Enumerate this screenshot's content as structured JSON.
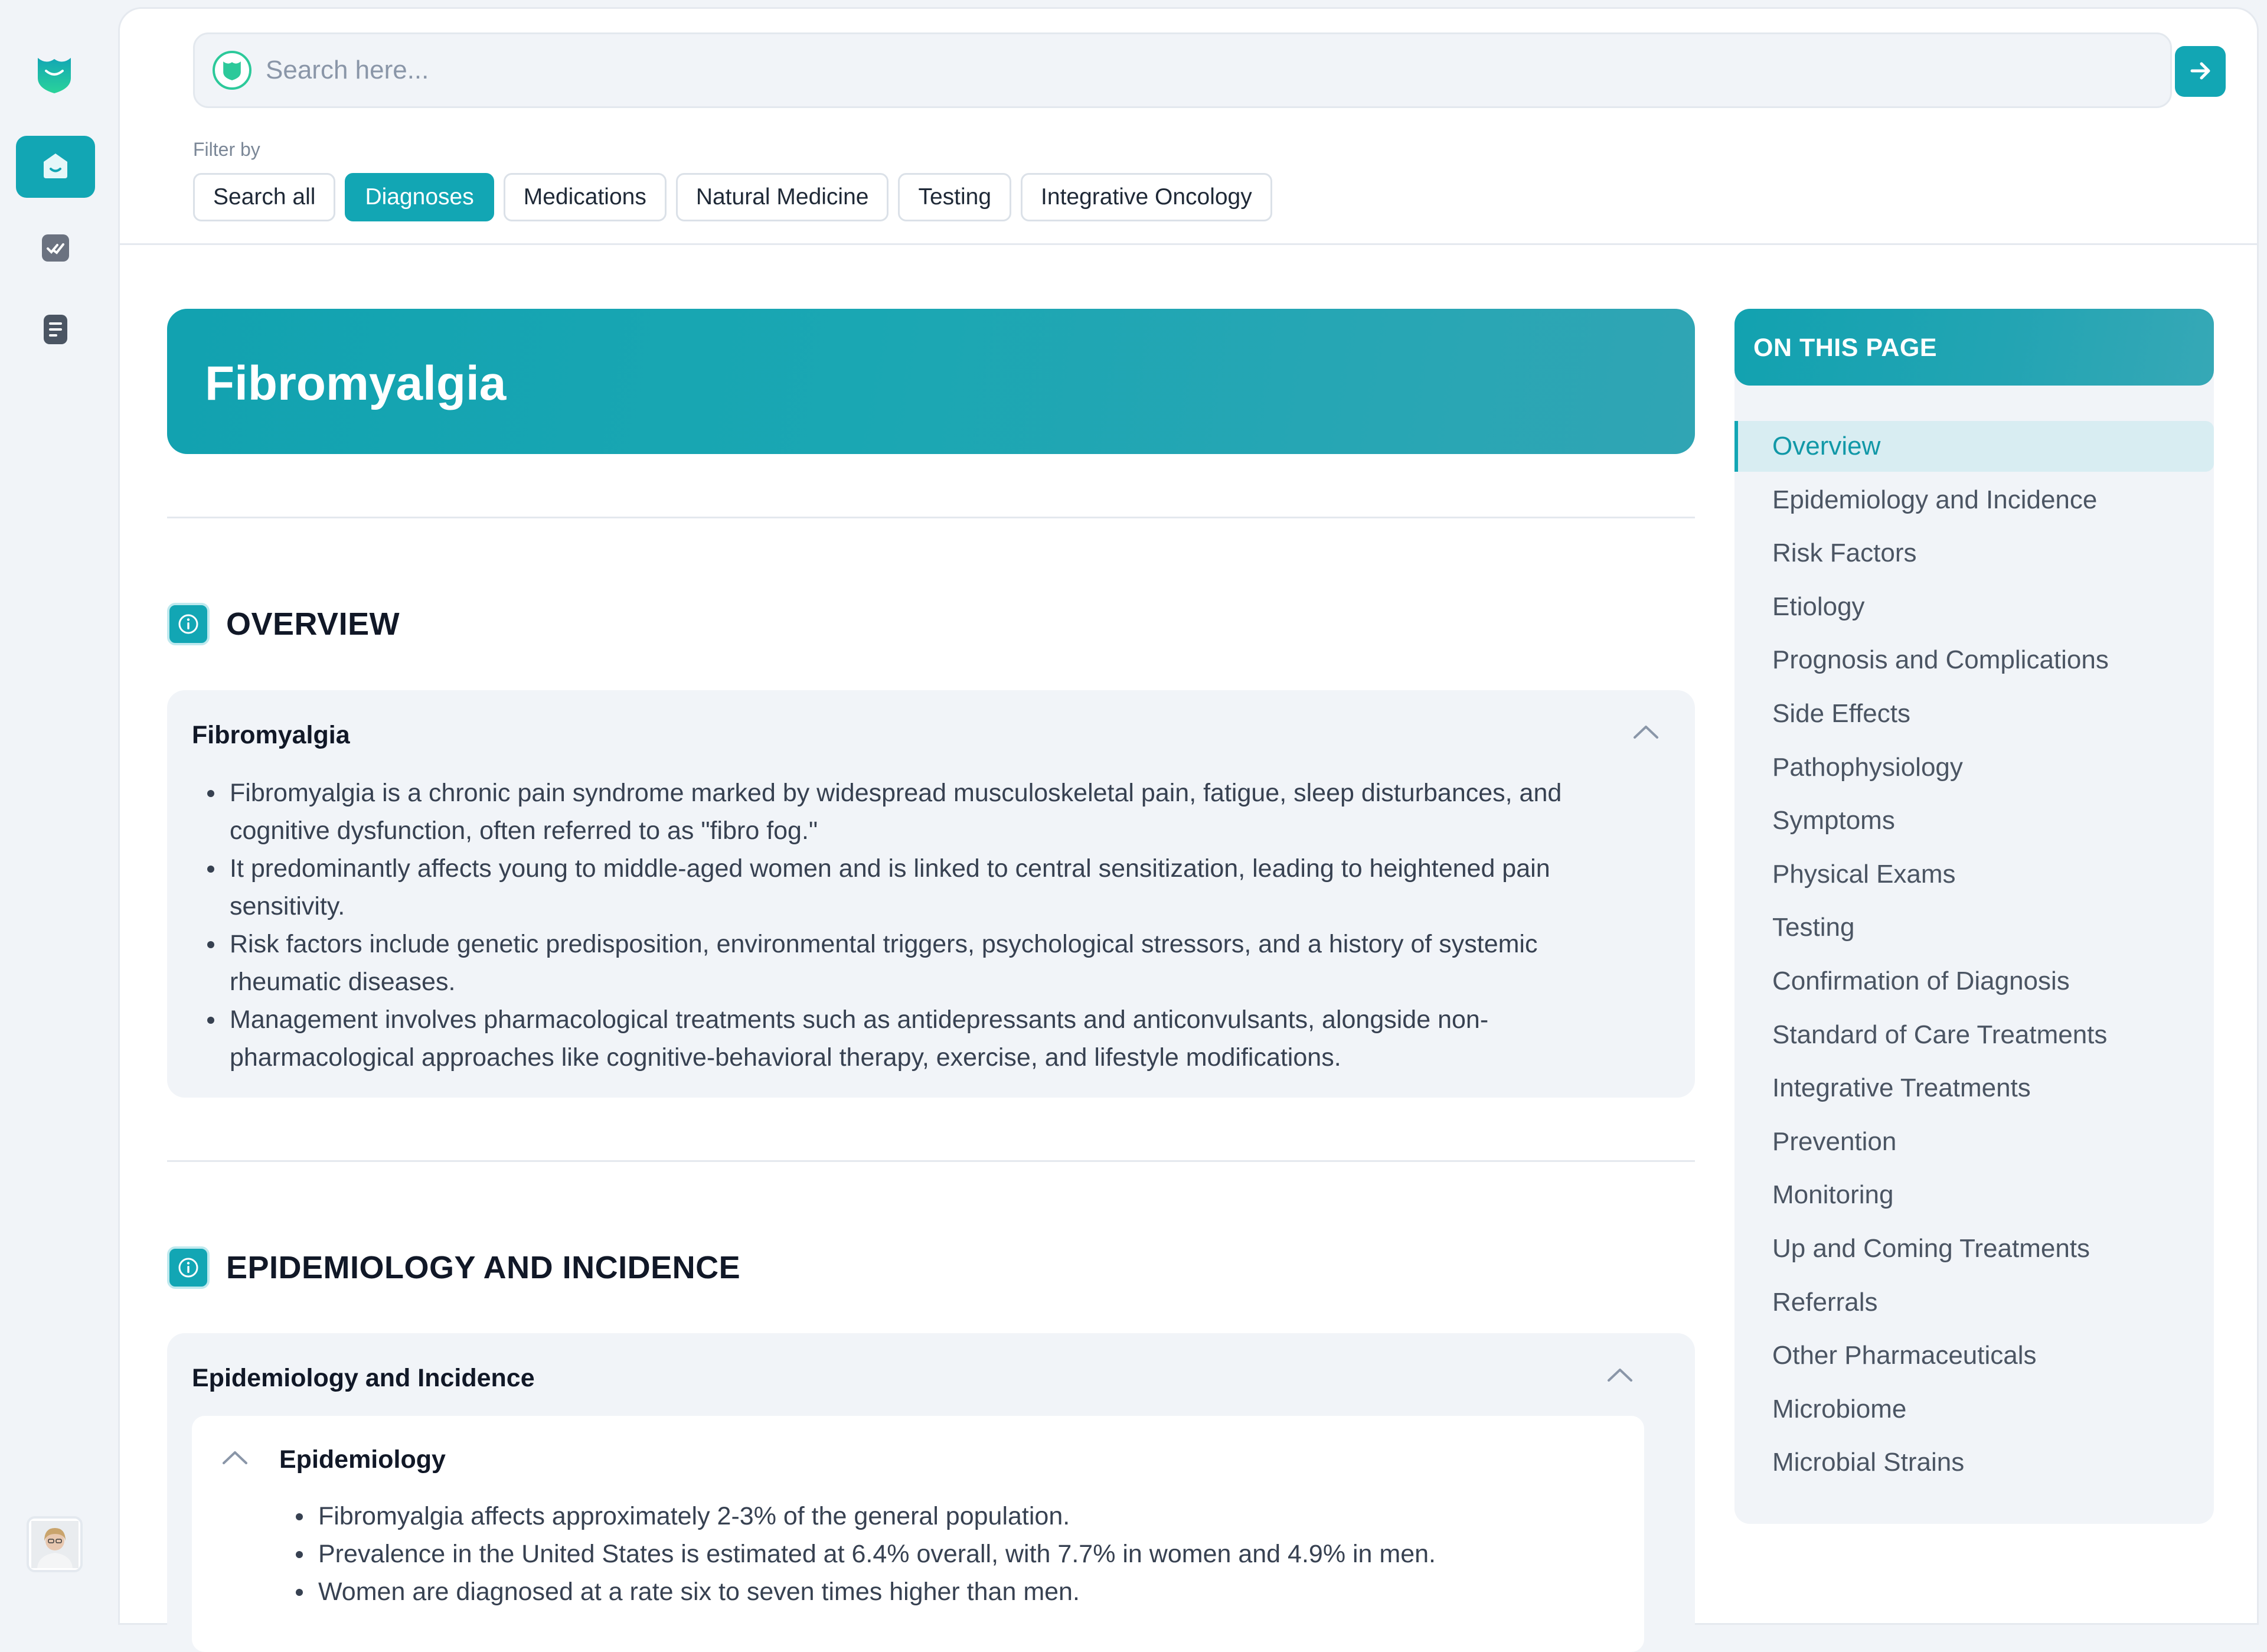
{
  "search": {
    "placeholder": "Search here..."
  },
  "filters": {
    "label": "Filter by",
    "chips": [
      {
        "label": "Search all",
        "active": false
      },
      {
        "label": "Diagnoses",
        "active": true
      },
      {
        "label": "Medications",
        "active": false
      },
      {
        "label": "Natural Medicine",
        "active": false
      },
      {
        "label": "Testing",
        "active": false
      },
      {
        "label": "Integrative Oncology",
        "active": false
      }
    ]
  },
  "hero": {
    "title": "Fibromyalgia"
  },
  "sections": {
    "overview": {
      "heading": "OVERVIEW",
      "panel_title": "Fibromyalgia",
      "bullets": [
        "Fibromyalgia is a chronic pain syndrome marked by widespread musculoskeletal pain, fatigue, sleep disturbances, and cognitive dysfunction, often referred to as \"fibro fog.\"",
        "It predominantly affects young to middle-aged women and is linked to central sensitization, leading to heightened pain sensitivity.",
        "Risk factors include genetic predisposition, environmental triggers, psychological stressors, and a history of systemic rheumatic diseases.",
        "Management involves pharmacological treatments such as antidepressants and anticonvulsants, alongside non-pharmacological approaches like cognitive-behavioral therapy, exercise, and lifestyle modifications."
      ]
    },
    "epidemiology": {
      "heading": "EPIDEMIOLOGY AND INCIDENCE",
      "panel_title": "Epidemiology and Incidence",
      "sub_title": "Epidemiology",
      "bullets": [
        "Fibromyalgia affects approximately 2-3% of the general population.",
        "Prevalence in the United States is estimated at 6.4% overall, with 7.7% in women and 4.9% in men.",
        "Women are diagnosed at a rate six to seven times higher than men."
      ]
    }
  },
  "toc": {
    "heading": "ON THIS PAGE",
    "items": [
      "Overview",
      "Epidemiology and Incidence",
      "Risk Factors",
      "Etiology",
      "Prognosis and Complications",
      "Side Effects",
      "Pathophysiology",
      "Symptoms",
      "Physical Exams",
      "Testing",
      "Confirmation of Diagnosis",
      "Standard of Care Treatments",
      "Integrative Treatments",
      "Prevention",
      "Monitoring",
      "Up and Coming Treatments",
      "Referrals",
      "Other Pharmaceuticals",
      "Microbiome",
      "Microbial Strains"
    ],
    "active_index": 0
  },
  "icons": {
    "logo": "shield-logo-icon",
    "home": "home-icon",
    "tasks": "checklist-icon",
    "notes": "document-icon",
    "submit": "arrow-right-icon",
    "section": "info-icon",
    "collapse": "chevron-up-icon"
  },
  "colors": {
    "accent": "#12a6b4",
    "logo_gradient": [
      "#2cc99a",
      "#12a6b4"
    ]
  }
}
